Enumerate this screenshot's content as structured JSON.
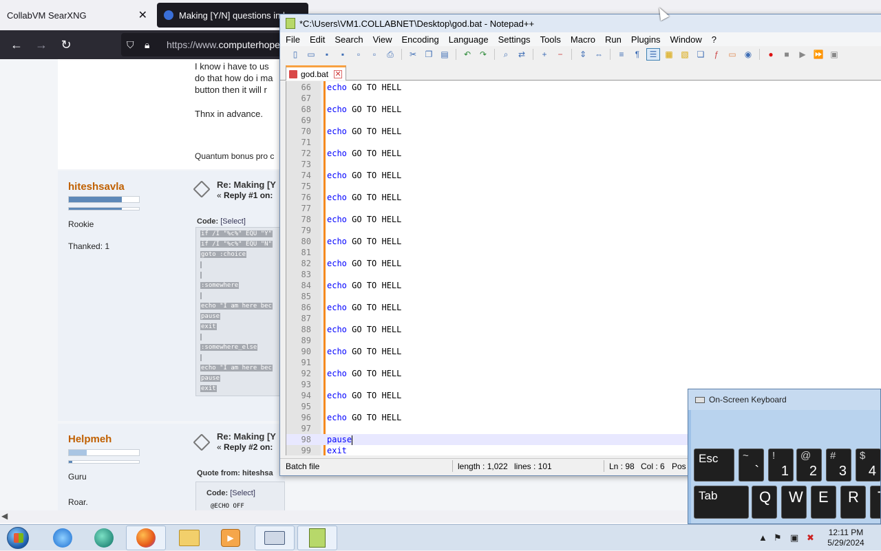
{
  "browser": {
    "tabs": [
      {
        "label": "CollabVM SearXNG",
        "close": "✕"
      },
      {
        "label": "Making [Y/N] questions in b"
      }
    ],
    "url_prefix": "https://www.",
    "url_domain": "computerhope",
    "nav": {
      "back": "←",
      "forward": "→",
      "reload": "↻"
    }
  },
  "forum": {
    "post0": {
      "lines": [
        "I know i have to us",
        "do that how do i ma",
        "button then it will r"
      ],
      "thanks": "Thnx in advance.",
      "signature": "Quantum bonus pro c"
    },
    "post1": {
      "username": "hiteshsavla",
      "rank": "Rookie",
      "thanked": "Thanked: 1",
      "reply_title": "Re: Making [Y",
      "reply_sub_prefix": "«",
      "reply_sub_bold": "Reply #1 on:",
      "code_label": "Code:",
      "code_select": "[Select]",
      "code_lines": [
        "if /I \"%c%\" EQU \"Y\"",
        "if /I \"%c%\" EQU \"N\"",
        "goto :choice",
        "",
        "",
        ":somewhere",
        "",
        "echo \"I am here bec",
        "pause",
        "exit",
        "",
        ":somewhere_else",
        "",
        "echo \"I am here bec",
        "pause",
        "exit"
      ],
      "rank_fill_pct": 75
    },
    "post2": {
      "username": "Helpmeh",
      "rank": "Guru",
      "extra": "Roar.",
      "reply_title": "Re: Making [Y",
      "reply_sub_prefix": "«",
      "reply_sub_bold": "Reply #2 on:",
      "quote_label": "Quote from: hiteshsa",
      "code_label": "Code:",
      "code_select": "[Select]",
      "code_first": "@ECHO OFF",
      "rank_fill_pct": 25,
      "post_fill_pct": 5
    }
  },
  "notepad": {
    "title": "*C:\\Users\\VM1.COLLABNET\\Desktop\\god.bat - Notepad++",
    "menu": [
      "File",
      "Edit",
      "Search",
      "View",
      "Encoding",
      "Language",
      "Settings",
      "Tools",
      "Macro",
      "Run",
      "Plugins",
      "Window",
      "?"
    ],
    "tab": {
      "label": "god.bat",
      "close": "✕"
    },
    "lines": [
      {
        "n": "66",
        "kw": "echo",
        "text": " GO TO HELL"
      },
      {
        "n": "67",
        "kw": "",
        "text": ""
      },
      {
        "n": "68",
        "kw": "echo",
        "text": " GO TO HELL"
      },
      {
        "n": "69",
        "kw": "",
        "text": ""
      },
      {
        "n": "70",
        "kw": "echo",
        "text": " GO TO HELL"
      },
      {
        "n": "71",
        "kw": "",
        "text": ""
      },
      {
        "n": "72",
        "kw": "echo",
        "text": " GO TO HELL"
      },
      {
        "n": "73",
        "kw": "",
        "text": ""
      },
      {
        "n": "74",
        "kw": "echo",
        "text": " GO TO HELL"
      },
      {
        "n": "75",
        "kw": "",
        "text": ""
      },
      {
        "n": "76",
        "kw": "echo",
        "text": " GO TO HELL"
      },
      {
        "n": "77",
        "kw": "",
        "text": ""
      },
      {
        "n": "78",
        "kw": "echo",
        "text": " GO TO HELL"
      },
      {
        "n": "79",
        "kw": "",
        "text": ""
      },
      {
        "n": "80",
        "kw": "echo",
        "text": " GO TO HELL"
      },
      {
        "n": "81",
        "kw": "",
        "text": ""
      },
      {
        "n": "82",
        "kw": "echo",
        "text": " GO TO HELL"
      },
      {
        "n": "83",
        "kw": "",
        "text": ""
      },
      {
        "n": "84",
        "kw": "echo",
        "text": " GO TO HELL"
      },
      {
        "n": "85",
        "kw": "",
        "text": ""
      },
      {
        "n": "86",
        "kw": "echo",
        "text": " GO TO HELL"
      },
      {
        "n": "87",
        "kw": "",
        "text": ""
      },
      {
        "n": "88",
        "kw": "echo",
        "text": " GO TO HELL"
      },
      {
        "n": "89",
        "kw": "",
        "text": ""
      },
      {
        "n": "90",
        "kw": "echo",
        "text": " GO TO HELL"
      },
      {
        "n": "91",
        "kw": "",
        "text": ""
      },
      {
        "n": "92",
        "kw": "echo",
        "text": " GO TO HELL"
      },
      {
        "n": "93",
        "kw": "",
        "text": ""
      },
      {
        "n": "94",
        "kw": "echo",
        "text": " GO TO HELL"
      },
      {
        "n": "95",
        "kw": "",
        "text": ""
      },
      {
        "n": "96",
        "kw": "echo",
        "text": " GO TO HELL"
      },
      {
        "n": "97",
        "kw": "",
        "text": ""
      },
      {
        "n": "98",
        "kw": "pause",
        "text": "",
        "current": true
      },
      {
        "n": "99",
        "kw": "exit",
        "text": ""
      }
    ],
    "status": {
      "lang": "Batch file",
      "length": "length : 1,022",
      "lines": "lines : 101",
      "ln": "Ln : 98",
      "col": "Col : 6",
      "pos": "Pos"
    },
    "accent_color": "#f58a1f",
    "keyword_color": "#0000ff"
  },
  "osk": {
    "title": "On-Screen Keyboard",
    "row1": [
      {
        "label": "Esc"
      },
      {
        "top": "~",
        "main": "`"
      },
      {
        "top": "!",
        "main": "1"
      },
      {
        "top": "@",
        "main": "2"
      },
      {
        "top": "#",
        "main": "3"
      },
      {
        "top": "$",
        "main": "4"
      }
    ],
    "row2": [
      {
        "label": "Tab"
      },
      {
        "letter": "Q"
      },
      {
        "letter": "W"
      },
      {
        "letter": "E"
      },
      {
        "letter": "R"
      },
      {
        "letter": "T"
      }
    ]
  },
  "taskbar": {
    "time": "12:11 PM",
    "date": "5/29/2024"
  }
}
